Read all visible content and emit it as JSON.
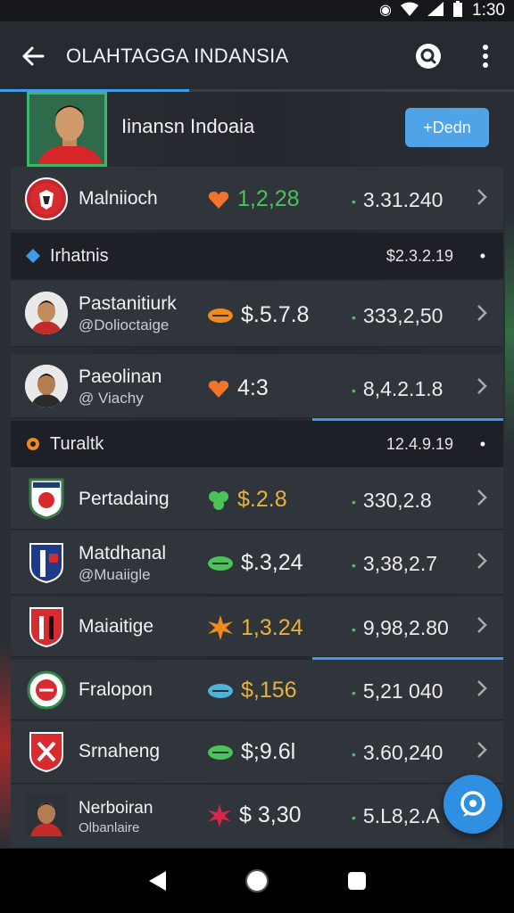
{
  "status_bar": {
    "time": "1:30"
  },
  "app_bar": {
    "title": "OLAHTAGGA INDANSIA"
  },
  "profile": {
    "name": "Iinansn Indoaia",
    "button_label": "+Dedn"
  },
  "rows_top": [
    {
      "name": "Malniioch",
      "mid": "1,2,28",
      "right": "3.31.240"
    }
  ],
  "section1": {
    "label": "Irhatnis",
    "value": "$2.3.2.19"
  },
  "players_a": [
    {
      "name": "Pastanitiurk",
      "sub": "@Dolioctaige",
      "mid": "$.5.7.8",
      "right": "333,2,50"
    },
    {
      "name": "Paeolinan",
      "sub": "@ Viachy",
      "mid": "4:3",
      "right": "8,4.2.1.8"
    }
  ],
  "section2": {
    "label": "Turaltk",
    "value": "12.4.9.19"
  },
  "rows_b": [
    {
      "name": "Pertadaing",
      "sub": "",
      "mid": "$.2.8",
      "right": "330,2.8"
    },
    {
      "name": "Matdhanal",
      "sub": "@Muaiigle",
      "mid": "$.3,24",
      "right": "3,38,2.7"
    },
    {
      "name": "Maiaitige",
      "sub": "",
      "mid": "1,3.24",
      "right": "9,98,2.80"
    },
    {
      "name": "Fralopon",
      "sub": "",
      "mid": "$,156",
      "right": "5,21 040"
    },
    {
      "name": "Srnaheng",
      "sub": "",
      "mid": "$;9.6l",
      "right": "3.60,240"
    },
    {
      "name": "Nerboiran",
      "sub": "Olbanlaire",
      "mid": "$ 3,30",
      "right": "5.L8,2.A"
    }
  ],
  "colors": {
    "accent": "#3d9be9",
    "positive": "#4cc25a",
    "gold": "#e8b23a",
    "fab": "#2f8fe0"
  }
}
